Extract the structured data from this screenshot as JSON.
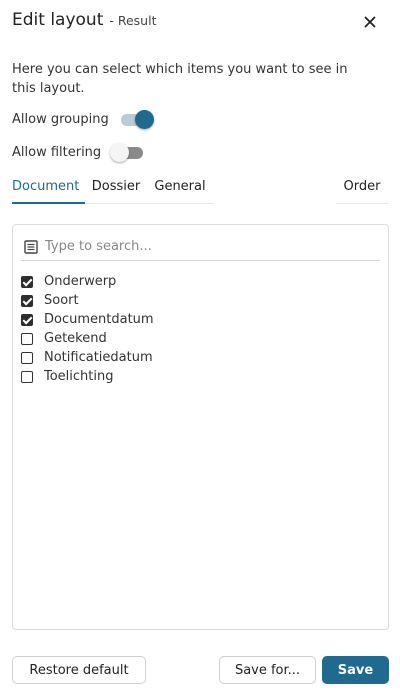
{
  "header": {
    "title": "Edit layout",
    "subtitle": "- Result",
    "close_icon": "close-icon"
  },
  "description": "Here you can select which items you want to see in this layout.",
  "toggles": {
    "grouping": {
      "label": "Allow grouping",
      "on": true
    },
    "filtering": {
      "label": "Allow filtering",
      "on": false
    }
  },
  "tabs": [
    {
      "label": "Document",
      "active": true
    },
    {
      "label": "Dossier",
      "active": false
    },
    {
      "label": "General",
      "active": false
    }
  ],
  "order_tab": {
    "label": "Order"
  },
  "search": {
    "placeholder": "Type to search...",
    "icon": "list-icon"
  },
  "items": [
    {
      "label": "Onderwerp",
      "checked": true
    },
    {
      "label": "Soort",
      "checked": true
    },
    {
      "label": "Documentdatum",
      "checked": true
    },
    {
      "label": "Getekend",
      "checked": false
    },
    {
      "label": "Notificatiedatum",
      "checked": false
    },
    {
      "label": "Toelichting",
      "checked": false
    }
  ],
  "footer": {
    "restore_label": "Restore default",
    "save_for_label": "Save for...",
    "save_label": "Save"
  },
  "colors": {
    "accent": "#1f6a8e",
    "toggle_on_track": "#b9cbd8",
    "toggle_off_track": "#8a8a8a"
  }
}
